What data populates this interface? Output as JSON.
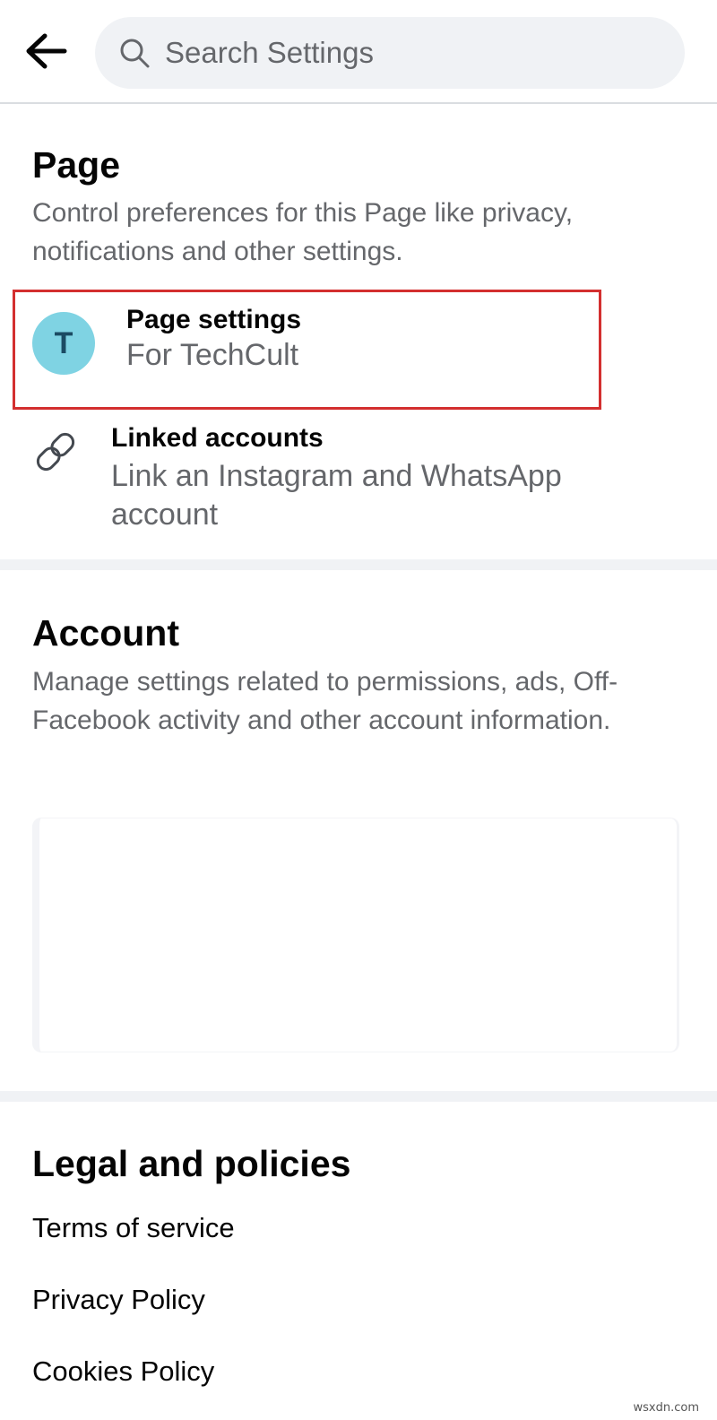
{
  "header": {
    "back_icon": "arrow-left-icon",
    "search_icon": "search-icon",
    "search_placeholder": "Search Settings",
    "search_value": ""
  },
  "page_section": {
    "title": "Page",
    "description": "Control preferences for this Page like privacy, notifications and other settings.",
    "items": [
      {
        "title": "Page settings",
        "subtitle": "For TechCult",
        "avatar_letter": "T",
        "avatar_color": "#7fd3e3",
        "highlighted": true,
        "highlight_color": "#d32f2f"
      },
      {
        "title": "Linked accounts",
        "subtitle": "Link an Instagram and WhatsApp account",
        "icon": "link-icon"
      }
    ]
  },
  "account_section": {
    "title": "Account",
    "description": "Manage settings related to permissions, ads, Off-Facebook activity and other account information."
  },
  "legal_section": {
    "title": "Legal and policies",
    "links": [
      "Terms of service",
      "Privacy Policy",
      "Cookies Policy"
    ]
  },
  "watermark": "wsxdn.com"
}
